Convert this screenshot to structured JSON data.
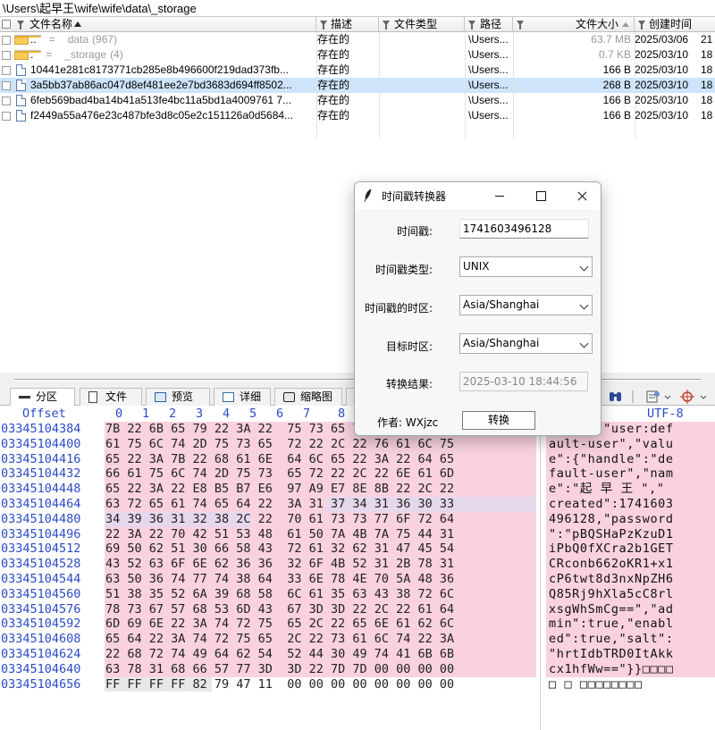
{
  "path": "\\Users\\起早王\\wife\\wife\\data\\_storage",
  "columns": {
    "name": "文件名称",
    "desc": "描述",
    "type": "文件类型",
    "path": "路径",
    "size": "文件大小",
    "created": "创建时间"
  },
  "rows": [
    {
      "kind": "folder",
      "name": "..",
      "name2": "=",
      "name3": "data",
      "count": "(967)",
      "desc": "存在的",
      "path": "\\Users...",
      "size": "63.7 MB",
      "created": "2025/03/06",
      "created_extra": "21",
      "dim": true
    },
    {
      "kind": "folder",
      "name": ".",
      "name2": "=",
      "name3": "_storage",
      "count": "(4)",
      "desc": "存在的",
      "path": "\\Users...",
      "size": "0.7 KB",
      "created": "2025/03/10",
      "created_extra": "18",
      "dim": true
    },
    {
      "kind": "file",
      "name": "10441e281c8173771cb285e8b496600f219dad373fb...",
      "desc": "存在的",
      "path": "\\Users...",
      "size": "166 B",
      "created": "2025/03/10",
      "created_extra": "18"
    },
    {
      "kind": "file",
      "name": "3a5bb37ab86ac047d8ef481ee2e7bd3683d694ff8502...",
      "desc": "存在的",
      "path": "\\Users...",
      "size": "268 B",
      "created": "2025/03/10",
      "created_extra": "18",
      "selected": true
    },
    {
      "kind": "file",
      "name": "6feb569bad4ba14b41a513fe4bc11a5bd1a4009761 7...",
      "desc": "存在的",
      "path": "\\Users...",
      "size": "166 B",
      "created": "2025/03/10",
      "created_extra": "18"
    },
    {
      "kind": "file",
      "name": "f2449a55a476e23c487bfe3d8c05e2c151126a0d5684...",
      "desc": "存在的",
      "path": "\\Users...",
      "size": "166 B",
      "created": "2025/03/10",
      "created_extra": "18"
    }
  ],
  "tabs": [
    "分区",
    "文件",
    "预览",
    "详细",
    "缩略图"
  ],
  "hex": {
    "offset_label": "Offset",
    "col_labels": [
      "0",
      "1",
      "2",
      "3",
      "4",
      "5",
      "6",
      "7",
      "8"
    ],
    "encoding": "UTF-8",
    "rows": [
      {
        "offset": "03345104384",
        "bytes": "7B 22 6B 65 79 22 3A 22  75 73 65 72 3A 64 65 66",
        "text": "{\"key\":\"user:def"
      },
      {
        "offset": "03345104400",
        "bytes": "61 75 6C 74 2D 75 73 65  72 22 2C 22 76 61 6C 75",
        "text": "ault-user\",\"valu"
      },
      {
        "offset": "03345104416",
        "bytes": "65 22 3A 7B 22 68 61 6E  64 6C 65 22 3A 22 64 65",
        "text": "e\":{\"handle\":\"de"
      },
      {
        "offset": "03345104432",
        "bytes": "66 61 75 6C 74 2D 75 73  65 72 22 2C 22 6E 61 6D",
        "text": "fault-user\",\"nam"
      },
      {
        "offset": "03345104448",
        "bytes": "65 22 3A 22 E8 B5 B7 E6  97 A9 E7 8E 8B 22 2C 22",
        "text": "e\":\"起 早 王 \",\""
      },
      {
        "offset": "03345104464",
        "bytes": "63 72 65 61 74 65 64 22  3A 31 37 34 31 36 30 33",
        "text": "created\":1741603"
      },
      {
        "offset": "03345104480",
        "bytes": "34 39 36 31 32 38 2C 22  70 61 73 73 77 6F 72 64",
        "text": "496128,\"password"
      },
      {
        "offset": "03345104496",
        "bytes": "22 3A 22 70 42 51 53 48  61 50 7A 4B 7A 75 44 31",
        "text": "\":\"pBQSHaPzKzuD1"
      },
      {
        "offset": "03345104512",
        "bytes": "69 50 62 51 30 66 58 43  72 61 32 62 31 47 45 54",
        "text": "iPbQ0fXCra2b1GET"
      },
      {
        "offset": "03345104528",
        "bytes": "43 52 63 6F 6E 62 36 36  32 6F 4B 52 31 2B 78 31",
        "text": "CRconb662oKR1+x1"
      },
      {
        "offset": "03345104544",
        "bytes": "63 50 36 74 77 74 38 64  33 6E 78 4E 70 5A 48 36",
        "text": "cP6twt8d3nxNpZH6"
      },
      {
        "offset": "03345104560",
        "bytes": "51 38 35 52 6A 39 68 58  6C 61 35 63 43 38 72 6C",
        "text": "Q85Rj9hXla5cC8rl"
      },
      {
        "offset": "03345104576",
        "bytes": "78 73 67 57 68 53 6D 43  67 3D 3D 22 2C 22 61 64",
        "text": "xsgWhSmCg==\",\"ad"
      },
      {
        "offset": "03345104592",
        "bytes": "6D 69 6E 22 3A 74 72 75  65 2C 22 65 6E 61 62 6C",
        "text": "min\":true,\"enabl"
      },
      {
        "offset": "03345104608",
        "bytes": "65 64 22 3A 74 72 75 65  2C 22 73 61 6C 74 22 3A",
        "text": "ed\":true,\"salt\":"
      },
      {
        "offset": "03345104624",
        "bytes": "22 68 72 74 49 64 62 54  52 44 30 49 74 41 6B 6B",
        "text": "\"hrtIdbTRD0ItAkk"
      },
      {
        "offset": "03345104640",
        "bytes": "63 78 31 68 66 57 77 3D  3D 22 7D 7D 00 00 00 00",
        "text": "cx1hfWw==\"}}□□□□"
      },
      {
        "offset": "03345104656",
        "bytes": "FF FF FF FF 82 79 47 11  00 00 00 00 00 00 00 00",
        "text": "□   □  □□□□□□□□"
      }
    ]
  },
  "dialog": {
    "title": "时间戳转换器",
    "timestamp_label": "时间戳:",
    "timestamp_value": "1741603496128",
    "type_label": "时间戳类型:",
    "type_value": "UNIX",
    "src_tz_label": "时间戳的时区:",
    "src_tz_value": "Asia/Shanghai",
    "dst_tz_label": "目标时区:",
    "dst_tz_value": "Asia/Shanghai",
    "result_label": "转换结果:",
    "result_value": "2025-03-10 18:44:56",
    "author_label": "作者: WXjzc",
    "convert_button": "转换"
  },
  "colors": {
    "selection": "#cde4fb",
    "hex_highlight": "#f9d2dd",
    "offset_blue": "#2a4bc8"
  }
}
